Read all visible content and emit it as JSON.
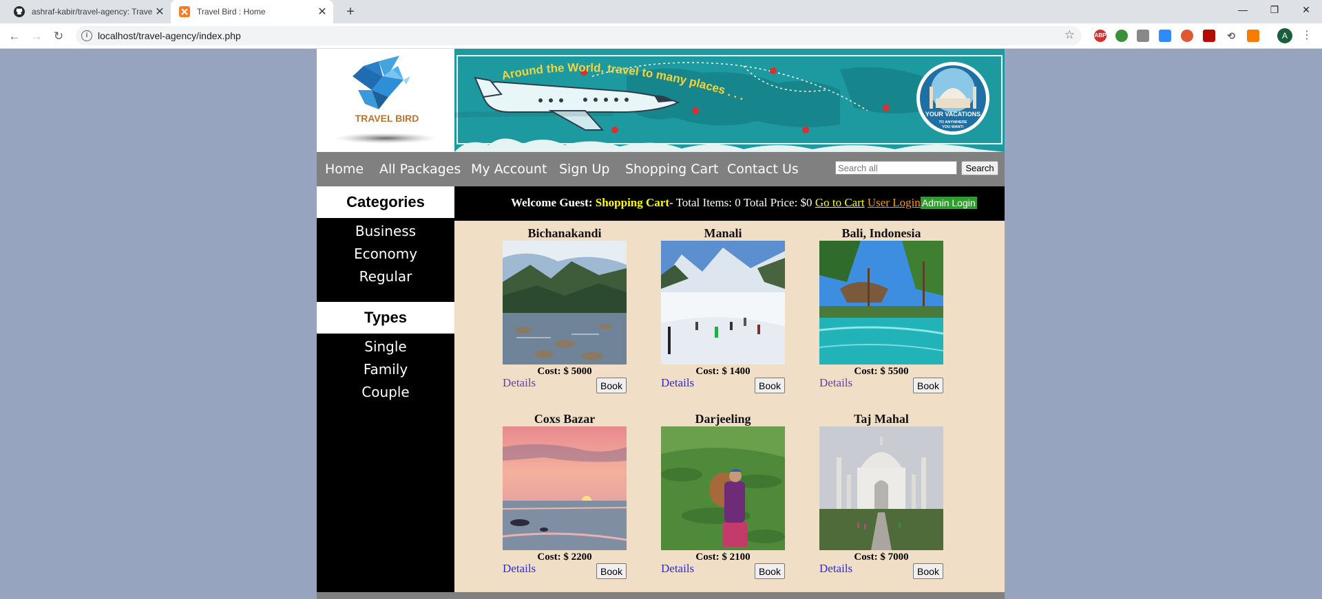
{
  "browser": {
    "tabs": [
      {
        "title": "ashraf-kabir/travel-agency: Trave",
        "active": false
      },
      {
        "title": "Travel Bird : Home",
        "active": true
      }
    ],
    "url": "localhost/travel-agency/index.php",
    "profile_initial": "A"
  },
  "site": {
    "logo_text": "TRAVEL BIRD",
    "banner": {
      "tagline": "Around the World, travel to many places . . .",
      "badge_line1": "YOUR VACATIONS",
      "badge_line2": "TO ANYWHERE",
      "badge_line3": "YOU WANT!"
    },
    "nav": {
      "home": "Home",
      "all_packages": "All Packages",
      "my_account": "My Account",
      "sign_up": "Sign Up",
      "shopping_cart": "Shopping Cart",
      "contact_us": "Contact Us"
    },
    "search": {
      "placeholder": "Search all",
      "button": "Search"
    },
    "sidebar": {
      "categories_title": "Categories",
      "categories": [
        "Business",
        "Economy",
        "Regular"
      ],
      "types_title": "Types",
      "types": [
        "Single",
        "Family",
        "Couple"
      ]
    },
    "cart": {
      "welcome": "Welcome Guest:",
      "shopping_cart": "Shopping Cart",
      "summary": "- Total Items: 0 Total Price: $0",
      "go_to_cart": "Go to Cart",
      "user_login": "User Login",
      "admin_login": "Admin Login"
    },
    "packages": [
      {
        "name": "Bichanakandi",
        "cost": "Cost: $ 5000",
        "details": "Details",
        "book": "Book"
      },
      {
        "name": "Manali",
        "cost": "Cost: $ 1400",
        "details": "Details",
        "book": "Book"
      },
      {
        "name": "Bali, Indonesia",
        "cost": "Cost: $ 5500",
        "details": "Details",
        "book": "Book"
      },
      {
        "name": "Coxs Bazar",
        "cost": "Cost: $ 2200",
        "details": "Details",
        "book": "Book"
      },
      {
        "name": "Darjeeling",
        "cost": "Cost: $ 2100",
        "details": "Details",
        "book": "Book"
      },
      {
        "name": "Taj Mahal",
        "cost": "Cost: $ 7000",
        "details": "Details",
        "book": "Book"
      }
    ]
  }
}
